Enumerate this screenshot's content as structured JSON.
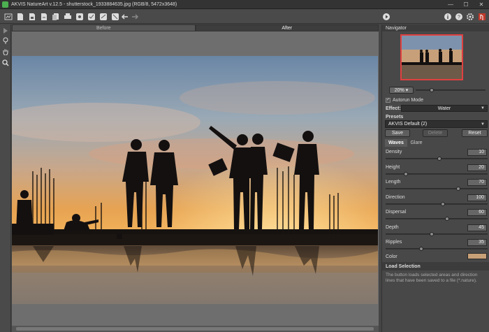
{
  "window": {
    "title": "AKVIS NatureArt v.12.5 - shutterstock_1933884635.jpg (RGB/8, 5472x3648)",
    "minimize": "—",
    "maximize": "☐",
    "close": "✕"
  },
  "toolbar": {
    "left_icons": [
      "home-icon",
      "open-file-icon",
      "save-file-icon",
      "save-as-icon",
      "batch-icon",
      "print-icon",
      "load-settings-icon",
      "save-settings-icon",
      "load-stroke-icon",
      "save-stroke-icon",
      "apply-icon",
      "undo-icon",
      "redo-icon"
    ],
    "right_icons": [
      "run-icon",
      "info-icon",
      "help-icon",
      "settings-icon",
      "exit-icon"
    ]
  },
  "tabs": {
    "before": "Before",
    "after": "After"
  },
  "navigator": {
    "header": "Navigator",
    "zoom": "20%"
  },
  "settings": {
    "autorun_label": "Autorun Mode",
    "autorun_checked": "✓",
    "effect_label": "Effect:",
    "effect_value": "Water",
    "presets_label": "Presets",
    "preset_value": "AKVIS Default (2)",
    "save_button": "Save",
    "delete_button": "Delete",
    "reset_button": "Reset"
  },
  "subtabs": {
    "waves": "Waves",
    "glare": "Glare"
  },
  "params": [
    {
      "label": "Density",
      "value": "10",
      "fraction": 0.53
    },
    {
      "label": "Height",
      "value": "20",
      "fraction": 0.2
    },
    {
      "label": "Length",
      "value": "70",
      "fraction": 0.71
    },
    {
      "label": "Direction",
      "value": "100",
      "fraction": 0.56
    },
    {
      "label": "Dispersal",
      "value": "60",
      "fraction": 0.6
    },
    {
      "label": "Depth",
      "value": "45",
      "fraction": 0.45
    },
    {
      "label": "Ripples",
      "value": "35",
      "fraction": 0.35
    }
  ],
  "color": {
    "label": "Color",
    "value": "#c8a078"
  },
  "help": {
    "title": "Load Selection",
    "text": "The button loads selected areas and direction lines that have been saved to a file (*.nature)."
  }
}
